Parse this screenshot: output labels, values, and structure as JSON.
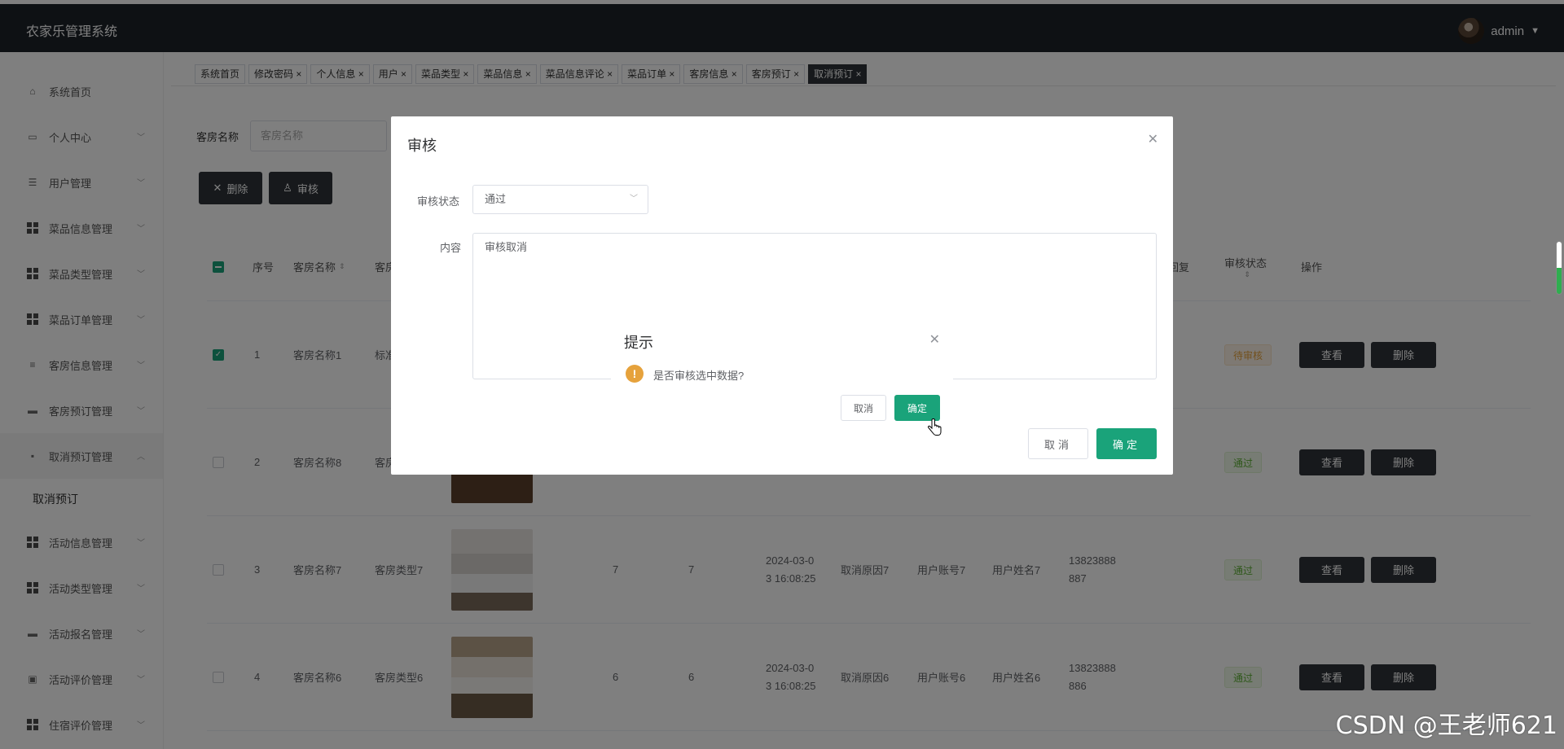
{
  "app": {
    "title": "农家乐管理系统",
    "user": "admin"
  },
  "sidebar": {
    "items": [
      {
        "label": "系统首页",
        "icon": "home-icon"
      },
      {
        "label": "个人中心",
        "icon": "card-icon"
      },
      {
        "label": "用户管理",
        "icon": "sliders-icon"
      },
      {
        "label": "菜品信息管理",
        "icon": "grid-icon"
      },
      {
        "label": "菜品类型管理",
        "icon": "grid-icon"
      },
      {
        "label": "菜品订单管理",
        "icon": "grid-icon"
      },
      {
        "label": "客房信息管理",
        "icon": "list-icon"
      },
      {
        "label": "客房预订管理",
        "icon": "monitor-icon"
      },
      {
        "label": "取消预订管理",
        "icon": "chat-icon"
      },
      {
        "label": "活动信息管理",
        "icon": "grid-icon"
      },
      {
        "label": "活动类型管理",
        "icon": "grid-icon"
      },
      {
        "label": "活动报名管理",
        "icon": "monitor-icon"
      },
      {
        "label": "活动评价管理",
        "icon": "clipboard-icon"
      },
      {
        "label": "住宿评价管理",
        "icon": "grid-icon"
      }
    ],
    "submenu": {
      "label": "取消预订"
    }
  },
  "tabs": [
    {
      "label": "系统首页"
    },
    {
      "label": "修改密码 ×"
    },
    {
      "label": "个人信息 ×"
    },
    {
      "label": "用户 ×"
    },
    {
      "label": "菜品类型 ×"
    },
    {
      "label": "菜品信息 ×"
    },
    {
      "label": "菜品信息评论 ×"
    },
    {
      "label": "菜品订单 ×"
    },
    {
      "label": "客房信息 ×"
    },
    {
      "label": "客房预订 ×"
    },
    {
      "label": "取消预订 ×"
    }
  ],
  "search": {
    "label": "客房名称",
    "placeholder": "客房名称"
  },
  "toolbar": {
    "delete_label": "删除",
    "audit_label": "审核"
  },
  "table": {
    "headers": {
      "index": "序号",
      "room_name": "客房名称",
      "room_type": "客房",
      "reply": "回复",
      "audit_status": "审核状态",
      "actions": "操作"
    },
    "rows": [
      {
        "index": "1",
        "room_name": "客房名称1",
        "room_type": "标准",
        "status": "待审核",
        "view": "查看",
        "delete": "删除"
      },
      {
        "index": "2",
        "room_name": "客房名称8",
        "room_type": "客房",
        "status": "通过",
        "view": "查看",
        "delete": "删除"
      },
      {
        "index": "3",
        "room_name": "客房名称7",
        "room_type": "客房类型7",
        "num_a": "7",
        "num_b": "7",
        "date_1": "2024-03-0",
        "date_2": "3 16:08:25",
        "reason": "取消原因7",
        "account": "用户账号7",
        "username": "用户姓名7",
        "phone_1": "13823888",
        "phone_2": "887",
        "status": "通过",
        "view": "查看",
        "delete": "删除"
      },
      {
        "index": "4",
        "room_name": "客房名称6",
        "room_type": "客房类型6",
        "num_a": "6",
        "num_b": "6",
        "date_1": "2024-03-0",
        "date_2": "3 16:08:25",
        "reason": "取消原因6",
        "account": "用户账号6",
        "username": "用户姓名6",
        "phone_1": "13823888",
        "phone_2": "886",
        "status": "通过",
        "view": "查看",
        "delete": "删除"
      }
    ]
  },
  "audit_dialog": {
    "title": "审核",
    "status_label": "审核状态",
    "status_value": "通过",
    "content_label": "内容",
    "content_value": "审核取消",
    "cancel_label": "取消",
    "ok_label": "确定"
  },
  "confirm_box": {
    "title": "提示",
    "message": "是否审核选中数据?",
    "cancel_label": "取消",
    "ok_label": "确定"
  },
  "watermark": "CSDN @王老师621",
  "colors": {
    "topbar": "#1c2229",
    "primary": "#1aa37a",
    "dark_button": "#2f3338",
    "pass": "#5daf34",
    "wait": "#e6a23c"
  }
}
